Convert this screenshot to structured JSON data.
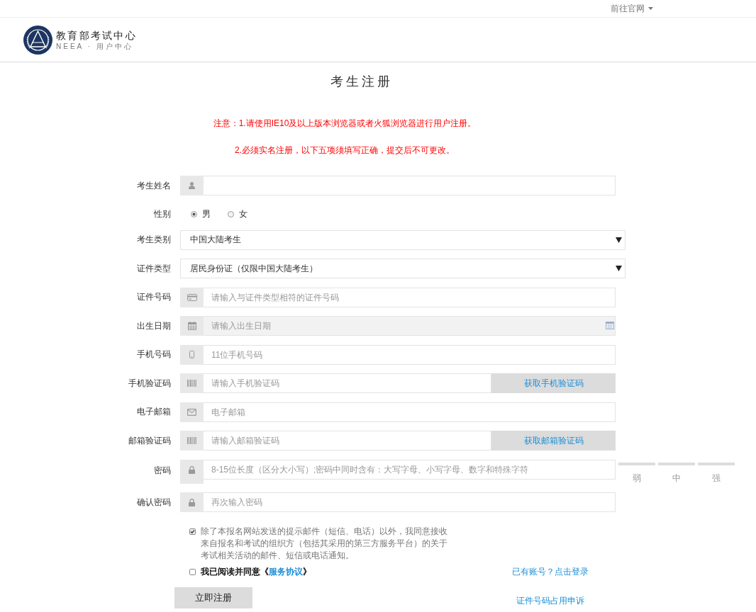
{
  "top_nav": {
    "link": "前往官网"
  },
  "header": {
    "title": "教育部考试中心",
    "subtitle": "NEEA · 用户中心"
  },
  "page_title": "考生注册",
  "notices": [
    "注意：1.请使用IE10及以上版本浏览器或者火狐浏览器进行用户注册。",
    "2.必须实名注册，以下五项须填写正确，提交后不可更改。"
  ],
  "fields": [
    {
      "kind": "name",
      "label": "考生姓名",
      "disabled": false
    },
    {
      "kind": "radio",
      "label": "性别",
      "disabled": false,
      "options": [
        {
          "label": "男",
          "selected": true
        },
        {
          "label": "女",
          "selected": false
        }
      ]
    },
    {
      "kind": "select",
      "label": "考生类别",
      "disabled": false,
      "value": "中国大陆考生"
    },
    {
      "kind": "select",
      "label": "证件类型",
      "disabled": false,
      "value": "居民身份证（仅限中国大陆考生）"
    },
    {
      "kind": "id",
      "label": "证件号码",
      "disabled": false,
      "placeholder": "请输入与证件类型相符的证件号码"
    },
    {
      "kind": "date",
      "label": "出生日期",
      "disabled": true,
      "placeholder": "请输入出生日期"
    },
    {
      "kind": "phone",
      "label": "手机号码",
      "disabled": false,
      "placeholder": "11位手机号码"
    },
    {
      "kind": "code",
      "label": "手机验证码",
      "disabled": false,
      "placeholder": "请输入手机验证码",
      "button": "获取手机验证码"
    },
    {
      "kind": "email",
      "label": "电子邮箱",
      "disabled": false,
      "placeholder": "电子邮箱"
    },
    {
      "kind": "code",
      "label": "邮箱验证码",
      "disabled": false,
      "placeholder": "请输入邮箱验证码",
      "button": "获取邮箱验证码"
    },
    {
      "kind": "password",
      "label": "密码",
      "disabled": false,
      "placeholder": "8-15位长度（区分大小写）;密码中同时含有：大写字母、小写字母、数字和特殊字符",
      "strength": [
        "弱",
        "中",
        "强"
      ]
    },
    {
      "kind": "password",
      "label": "确认密码",
      "disabled": false,
      "placeholder": "再次输入密码"
    }
  ],
  "consent": {
    "checked": true,
    "text": "除了本报名网站发送的提示邮件（短信、电话）以外，我同意接收来自报名和考试的组织方（包括其采用的第三方服务平台）的关于考试相关活动的邮件、短信或电话通知。"
  },
  "agreement": {
    "checked": false,
    "text": "我已阅读并同意《",
    "link": "服务协议",
    "after": "》"
  },
  "login_link": "已有账号？点击登录",
  "submit_button": "立即注册",
  "appeal_link": "证件号码占用申诉"
}
